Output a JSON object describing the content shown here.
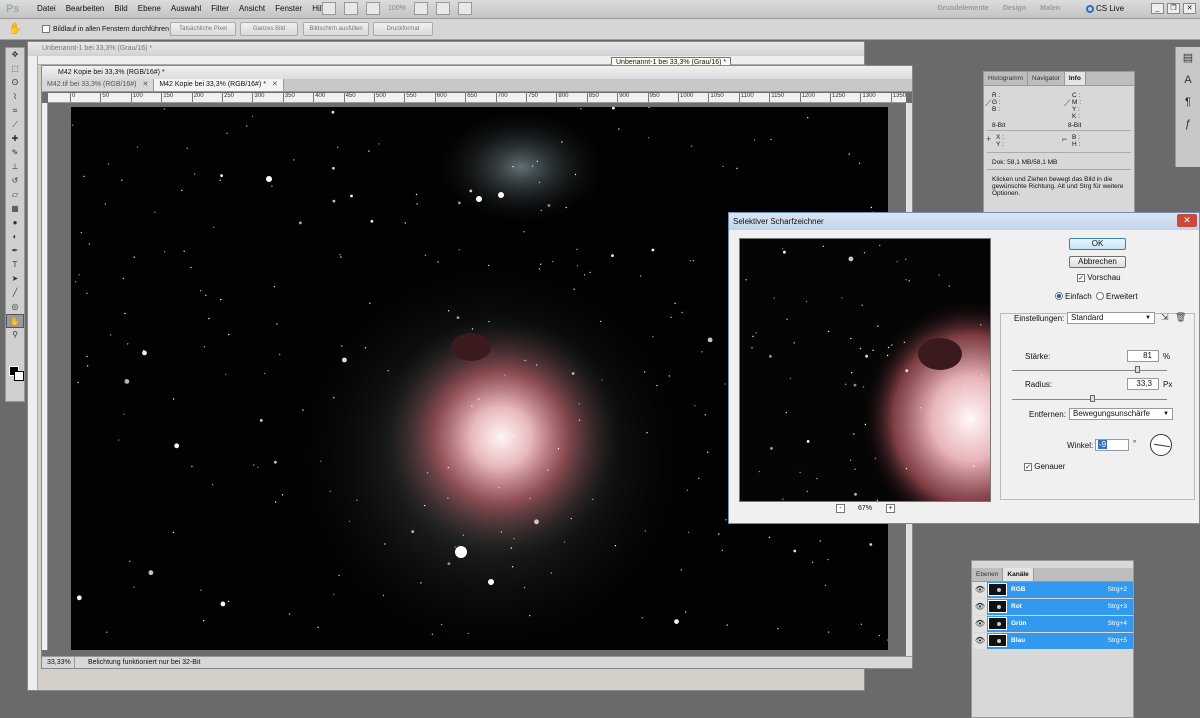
{
  "app": {
    "logo": "Ps",
    "menus": [
      "Datei",
      "Bearbeiten",
      "Bild",
      "Ebene",
      "Auswahl",
      "Filter",
      "Ansicht",
      "Fenster",
      "Hilfe"
    ],
    "zoom": "100%",
    "workspaces": [
      "Grundelemente",
      "Design",
      "Malen"
    ],
    "cs_live": "CS Live"
  },
  "options_bar": {
    "scroll_all_label": "Bildlauf in allen Fenstern durchführen",
    "buttons": [
      "Tatsächliche Pixel",
      "Ganzes Bild",
      "Bildschirm ausfüllen",
      "Druckformat"
    ]
  },
  "doc_back": {
    "title": "Unbenannt-1 bei 33,3% (Grau/16) *",
    "tooltip": "Unbenannt-1 bei 33,3% (Grau/16) *"
  },
  "doc_front": {
    "title": "M42 Kopie bei 33,3% (RGB/16#) *",
    "tabs": [
      "M42.tif bei 33,3% (RGB/16#)",
      "M42 Kopie bei 33,3% (RGB/16#) *"
    ],
    "ruler_ticks": [
      "0",
      "50",
      "100",
      "150",
      "200",
      "250",
      "300",
      "350",
      "400",
      "450",
      "500",
      "550",
      "600",
      "650",
      "700",
      "750",
      "800",
      "850",
      "900",
      "950",
      "1000",
      "1050",
      "1100",
      "1150",
      "1200",
      "1250",
      "1300",
      "1350"
    ],
    "zoom": "33,33%",
    "status": "Belichtung funktioniert nur bei 32-Bit"
  },
  "info_panel": {
    "tabs": [
      "Histogramm",
      "Navigator",
      "Info"
    ],
    "rgb_labels": [
      "R :",
      "G :",
      "B :"
    ],
    "cmyk_labels": [
      "C :",
      "M :",
      "Y :",
      "K :"
    ],
    "bitdepth_left": "8-Bit",
    "bitdepth_right": "8-Bit",
    "xy_labels": [
      "X :",
      "Y :"
    ],
    "bh_labels": [
      "B :",
      "H :"
    ],
    "doc_size": "Dok: 58,1 MB/58,1 MB",
    "hint": "Klicken und Ziehen bewegt das Bild in die gewünschte Richtung. Alt und Strg für weitere Optionen."
  },
  "layers_panel": {
    "tabs": [
      "Ebenen",
      "Kanäle"
    ],
    "channels": [
      {
        "name": "RGB",
        "shortcut": "Strg+2"
      },
      {
        "name": "Rot",
        "shortcut": "Strg+3"
      },
      {
        "name": "Grün",
        "shortcut": "Strg+4"
      },
      {
        "name": "Blau",
        "shortcut": "Strg+5"
      }
    ]
  },
  "dialog": {
    "title": "Selektiver Scharfzeichner",
    "ok": "OK",
    "cancel": "Abbrechen",
    "preview_label": "Vorschau",
    "preview_checked": true,
    "mode_simple": "Einfach",
    "mode_advanced": "Erweitert",
    "mode_selected": "Einfach",
    "preview_zoom": "67%",
    "settings_label": "Einstellungen:",
    "settings_value": "Standard",
    "amount_label": "Stärke:",
    "amount_value": "81",
    "amount_unit": "%",
    "amount_fraction": 0.81,
    "radius_label": "Radius:",
    "radius_value": "33,3",
    "radius_unit": "Px",
    "radius_fraction": 0.52,
    "remove_label": "Entfernen:",
    "remove_value": "Bewegungsunschärfe",
    "angle_label": "Winkel:",
    "angle_value": "-9",
    "angle_unit": "°",
    "accurate_label": "Genauer",
    "accurate_checked": true
  }
}
